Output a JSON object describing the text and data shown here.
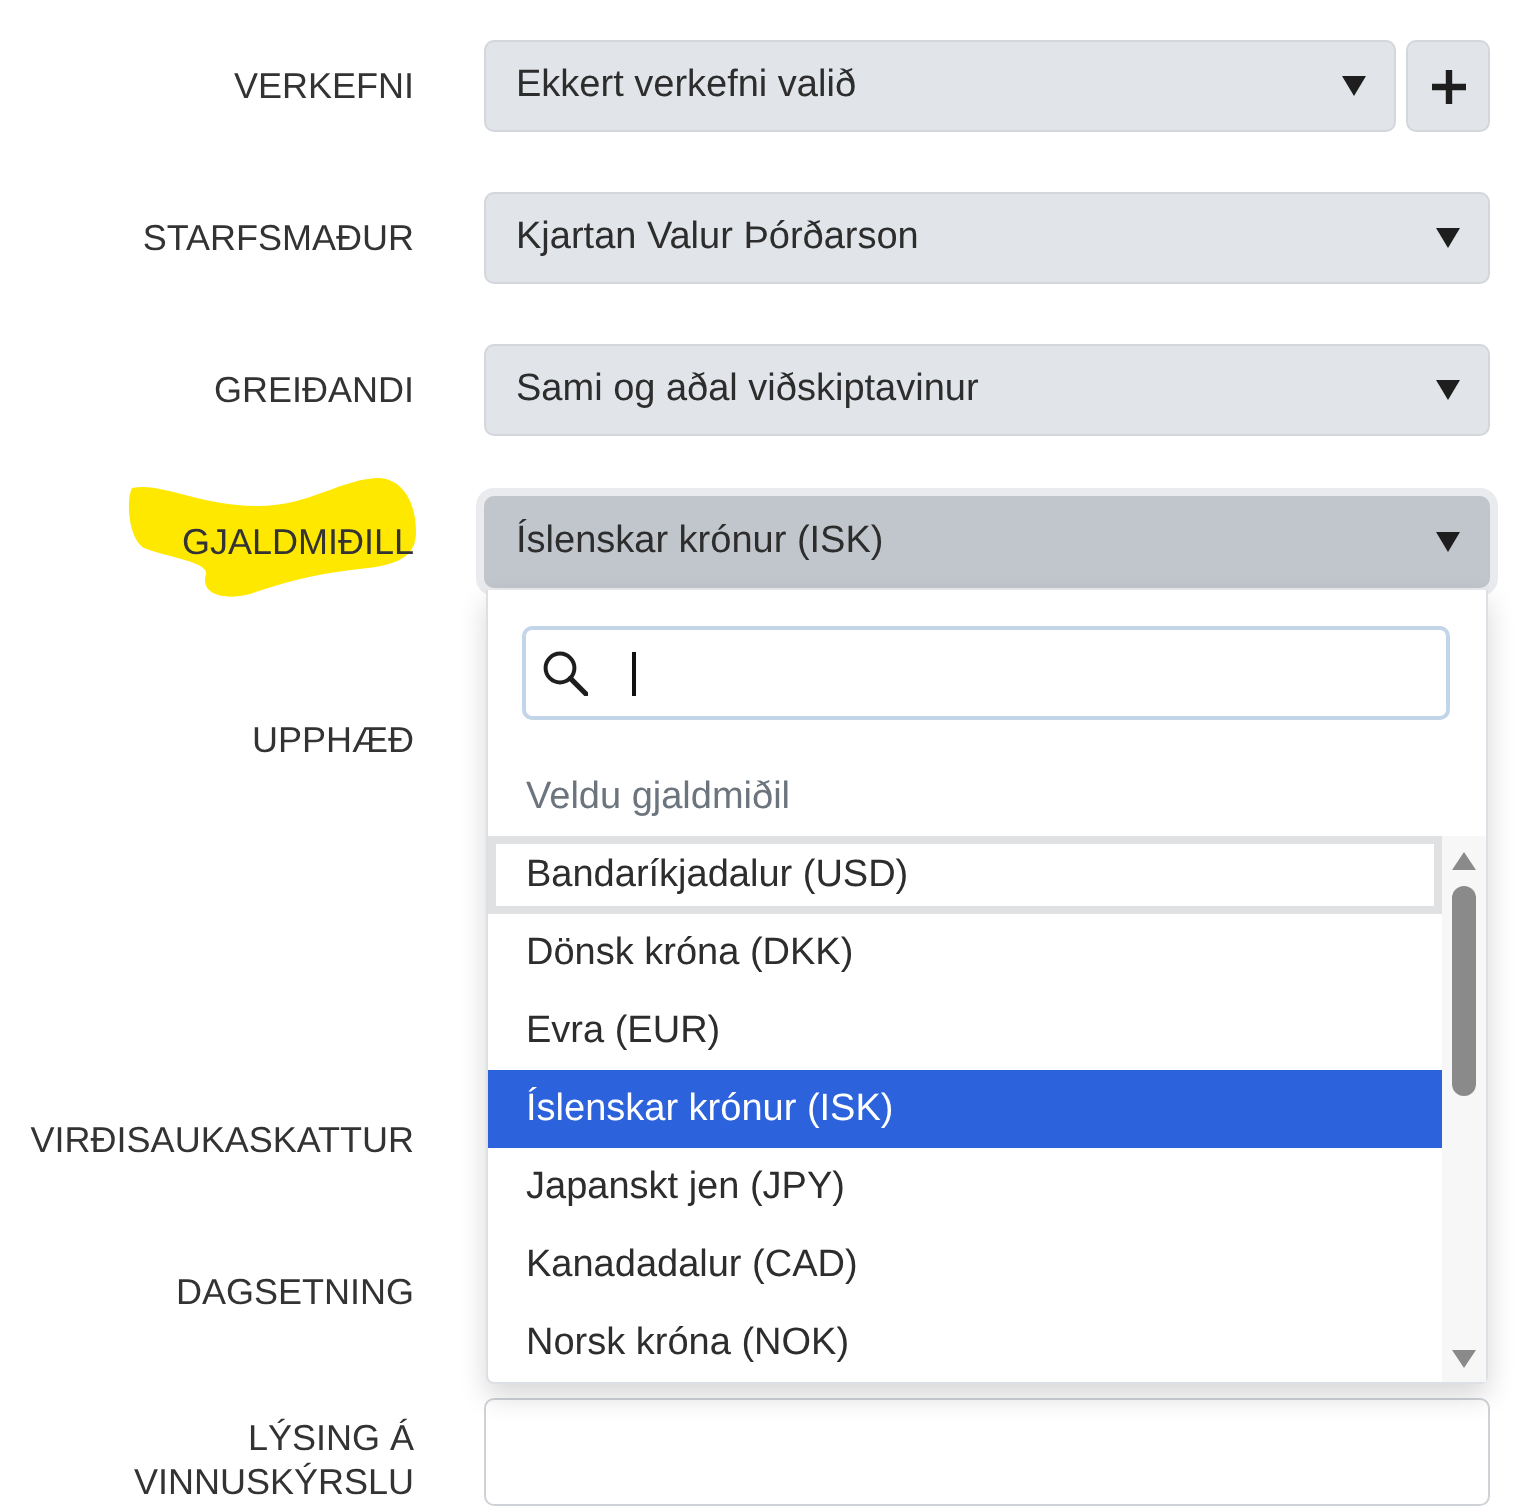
{
  "form": {
    "fields": [
      {
        "label": "VERKEFNI",
        "kind": "select",
        "value": "Ekkert verkefni valið",
        "add_button": true,
        "highlighted": false,
        "open": false
      },
      {
        "label": "STARFSMAÐUR",
        "kind": "select",
        "value": "Kjartan Valur Þórðarson",
        "add_button": false,
        "highlighted": false,
        "open": false
      },
      {
        "label": "GREIÐANDI",
        "kind": "select",
        "value": "Sami og aðal viðskiptavinur",
        "add_button": false,
        "highlighted": false,
        "open": false
      },
      {
        "label": "GJALDMIÐILL",
        "kind": "select",
        "value": "Íslenskar krónur (ISK)",
        "add_button": false,
        "highlighted": true,
        "open": true,
        "dropdown": {
          "search": {
            "focused": true
          },
          "hint": "Veldu gjaldmiðil",
          "options": [
            {
              "label": "Bandaríkjadalur (USD)",
              "selected": false,
              "focused": true
            },
            {
              "label": "Dönsk króna (DKK)",
              "selected": false,
              "focused": false
            },
            {
              "label": "Evra (EUR)",
              "selected": false,
              "focused": false
            },
            {
              "label": "Íslenskar krónur (ISK)",
              "selected": true,
              "focused": false
            },
            {
              "label": "Japanskt jen (JPY)",
              "selected": false,
              "focused": false
            },
            {
              "label": "Kanadadalur (CAD)",
              "selected": false,
              "focused": false
            },
            {
              "label": "Norsk króna (NOK)",
              "selected": false,
              "focused": false
            }
          ]
        }
      },
      {
        "label": "UPPHÆÐ",
        "kind": "label",
        "highlighted": false
      },
      {
        "label": "VIRÐISAUKASKATTUR",
        "kind": "label",
        "highlighted": false
      },
      {
        "label": "DAGSETNING",
        "kind": "label",
        "highlighted": false
      },
      {
        "label": "LÝSING Á VINNUSKÝRSLU",
        "kind": "textarea",
        "highlighted": false
      }
    ]
  }
}
